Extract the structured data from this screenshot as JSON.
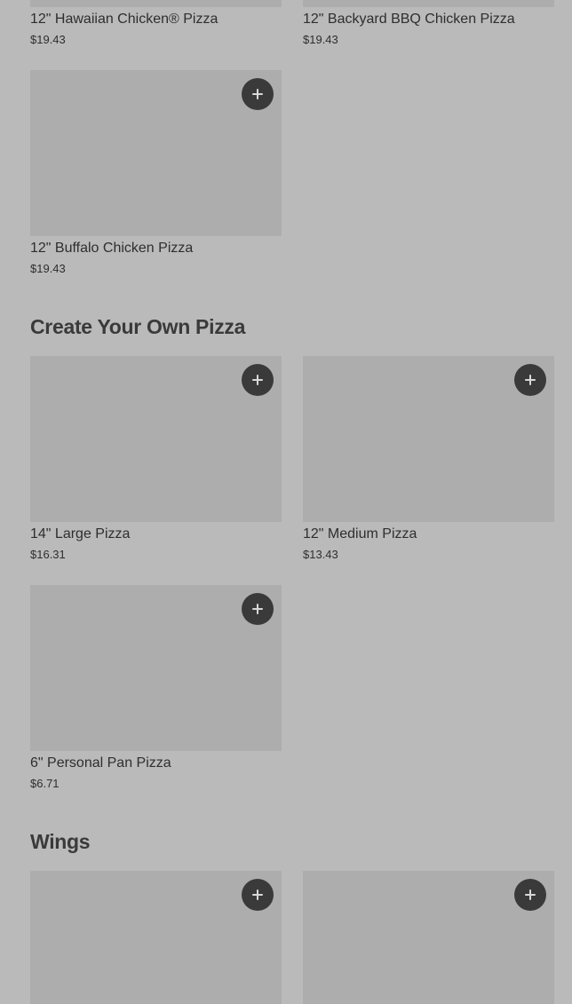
{
  "sections": {
    "top": {
      "items": [
        {
          "name": "12\" Hawaiian Chicken® Pizza",
          "price": "$19.43"
        },
        {
          "name": "12\" Backyard BBQ Chicken Pizza",
          "price": "$19.43"
        },
        {
          "name": "12\" Buffalo Chicken Pizza",
          "price": "$19.43",
          "add_icon": "plus-icon"
        }
      ]
    },
    "create_your_own": {
      "title": "Create Your Own Pizza",
      "items": [
        {
          "name": "14\" Large Pizza",
          "price": "$16.31",
          "add_icon": "plus-icon"
        },
        {
          "name": "12\" Medium Pizza",
          "price": "$13.43",
          "add_icon": "plus-icon"
        },
        {
          "name": "6\" Personal Pan Pizza",
          "price": "$6.71",
          "add_icon": "plus-icon"
        }
      ]
    },
    "wings": {
      "title": "Wings",
      "items": [
        {
          "add_icon": "plus-icon"
        },
        {
          "add_icon": "plus-icon"
        }
      ]
    }
  },
  "colors": {
    "background": "#bababa",
    "image_placeholder": "#adadad",
    "add_button": "#3a3a3a",
    "text": "#2e2e2e"
  }
}
